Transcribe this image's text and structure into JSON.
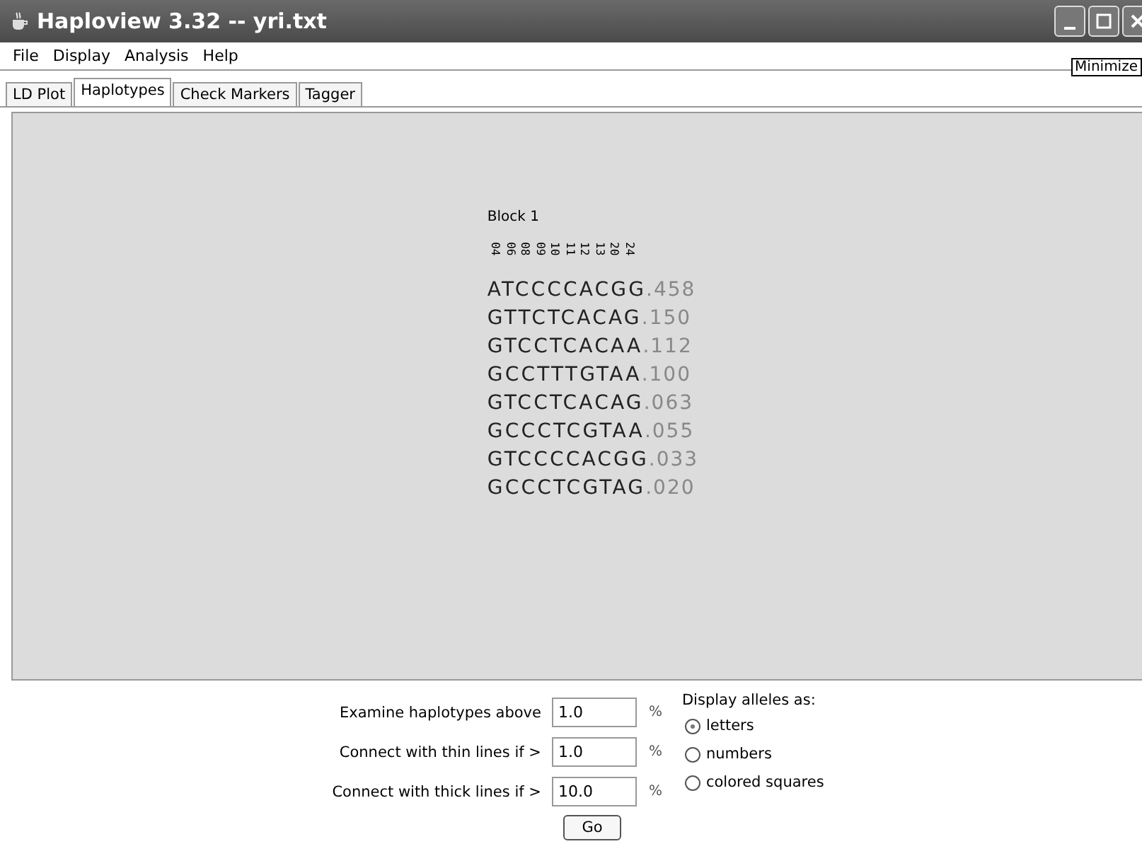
{
  "window": {
    "title": "Haploview 3.32 -- yri.txt"
  },
  "menu": [
    "File",
    "Display",
    "Analysis",
    "Help"
  ],
  "tooltip": "Minimize",
  "tabs": [
    {
      "label": "LD Plot",
      "selected": false
    },
    {
      "label": "Haplotypes",
      "selected": true
    },
    {
      "label": "Check Markers",
      "selected": false
    },
    {
      "label": "Tagger",
      "selected": false
    }
  ],
  "block": {
    "title": "Block 1",
    "markers": [
      "04",
      "06",
      "08",
      "09",
      "10",
      "11",
      "12",
      "13",
      "20",
      "24"
    ],
    "haplotypes": [
      {
        "alleles": "ATCCCCACGG",
        "freq": ".458"
      },
      {
        "alleles": "GTTCTCACAG",
        "freq": ".150"
      },
      {
        "alleles": "GTCCTCACAA",
        "freq": ".112"
      },
      {
        "alleles": "GCCTTTGTAA",
        "freq": ".100"
      },
      {
        "alleles": "GTCCTCACAG",
        "freq": ".063"
      },
      {
        "alleles": "GCCCTCGTAA",
        "freq": ".055"
      },
      {
        "alleles": "GTCCCCACGG",
        "freq": ".033"
      },
      {
        "alleles": "GCCCTCGTAG",
        "freq": ".020"
      }
    ]
  },
  "fields": [
    {
      "label": "Examine haplotypes above",
      "value": "1.0",
      "unit": "%"
    },
    {
      "label": "Connect with thin lines if >",
      "value": "1.0",
      "unit": "%"
    },
    {
      "label": "Connect with thick lines if >",
      "value": "10.0",
      "unit": "%"
    }
  ],
  "display": {
    "label": "Display alleles as:",
    "options": [
      {
        "label": "letters",
        "selected": true
      },
      {
        "label": "numbers",
        "selected": false
      },
      {
        "label": "colored squares",
        "selected": false
      }
    ]
  },
  "go_button": "Go"
}
